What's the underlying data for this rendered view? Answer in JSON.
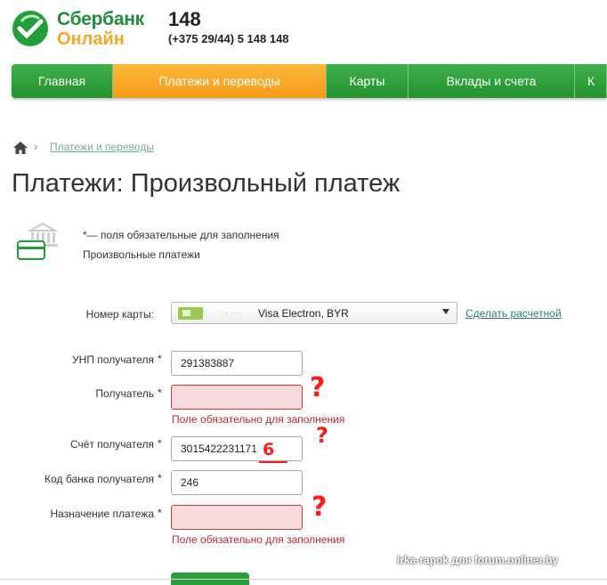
{
  "header": {
    "logo_line1": "Сбербанк",
    "logo_line2": "Онлайн",
    "phone_short": "148",
    "phone_long": "(+375 29/44) 5 148 148"
  },
  "nav": {
    "tabs": [
      {
        "label": "Главная",
        "active": false
      },
      {
        "label": "Платежи и переводы",
        "active": true
      },
      {
        "label": "Карты",
        "active": false
      },
      {
        "label": "Вклады и счета",
        "active": false
      },
      {
        "label": "К",
        "active": false
      }
    ]
  },
  "breadcrumb": {
    "home_icon": "home-icon",
    "item": "Платежи и переводы"
  },
  "page_title": "Платежи: Произвольный платеж",
  "notes": {
    "required": "*— поля обязательные для заполнения",
    "category": "Произвольные платежи"
  },
  "form": {
    "card": {
      "label": "Номер карты:",
      "mask": "·  ·  ·",
      "value": "Visa Electron, BYR",
      "link": "Сделать расчетной"
    },
    "unp": {
      "label": "УНП получателя",
      "star": "*",
      "value": "291383887"
    },
    "recipient": {
      "label": "Получатель",
      "star": "*",
      "value": "",
      "error": "Поле обязательно для заполнения"
    },
    "account": {
      "label": "Счёт получателя",
      "star": "*",
      "value": "3015422231171"
    },
    "bank_code": {
      "label": "Код банка получателя",
      "star": "*",
      "value": "246"
    },
    "purpose": {
      "label": "Назначение платежа",
      "star": "*",
      "value": "",
      "error": "Поле обязательно для заполнения"
    }
  },
  "annotations": {
    "q": "?",
    "six": "6"
  },
  "watermark": "irka-rapok для forum.onliner.by",
  "colors": {
    "brand_green": "#21a038",
    "active_orange": "#f7a823",
    "error_red": "#c0262c",
    "error_bg": "#f9dbde"
  }
}
